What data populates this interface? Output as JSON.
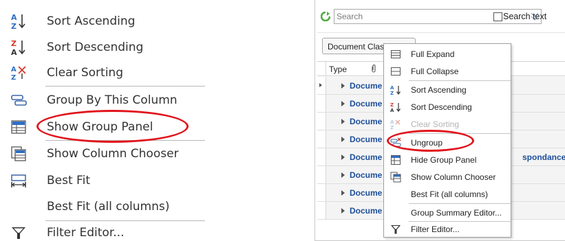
{
  "left_menu": {
    "items": [
      {
        "label": "Sort Ascending",
        "icon": "sort-ascending-icon"
      },
      {
        "label": "Sort Descending",
        "icon": "sort-descending-icon"
      },
      {
        "label": "Clear Sorting",
        "icon": "clear-sorting-icon"
      },
      {
        "label": "Group By This Column",
        "icon": "group-by-column-icon"
      },
      {
        "label": "Show Group Panel",
        "icon": "show-group-panel-icon"
      },
      {
        "label": "Show Column Chooser",
        "icon": "column-chooser-icon"
      },
      {
        "label": "Best Fit",
        "icon": "best-fit-icon"
      },
      {
        "label": "Best Fit (all columns)",
        "icon": ""
      },
      {
        "label": "Filter Editor...",
        "icon": "filter-icon"
      }
    ]
  },
  "app": {
    "search": {
      "placeholder": "Search"
    },
    "search_text_label": "Search text",
    "group_chip": "Document Clas",
    "columns": {
      "type": "Type"
    },
    "rows": [
      "Docume",
      "Docume",
      "Docume",
      "Docume",
      "Docume",
      "Docume",
      "Docume",
      "Docume"
    ],
    "side_text": "spondance",
    "context_menu": {
      "items": [
        {
          "label": "Full Expand",
          "icon": "full-expand-icon",
          "disabled": false
        },
        {
          "label": "Full Collapse",
          "icon": "full-collapse-icon",
          "disabled": false
        },
        {
          "label": "Sort Ascending",
          "icon": "sort-ascending-icon",
          "disabled": false
        },
        {
          "label": "Sort Descending",
          "icon": "sort-descending-icon",
          "disabled": false
        },
        {
          "label": "Clear Sorting",
          "icon": "clear-sorting-icon",
          "disabled": true
        },
        {
          "label": "Ungroup",
          "icon": "ungroup-icon",
          "disabled": false
        },
        {
          "label": "Hide Group Panel",
          "icon": "hide-group-panel-icon",
          "disabled": false
        },
        {
          "label": "Show Column Chooser",
          "icon": "column-chooser-icon",
          "disabled": false
        },
        {
          "label": "Best Fit (all columns)",
          "icon": "",
          "disabled": false
        },
        {
          "label": "Group Summary Editor...",
          "icon": "",
          "disabled": false
        },
        {
          "label": "Filter Editor...",
          "icon": "filter-icon",
          "disabled": false
        }
      ]
    }
  },
  "colors": {
    "highlight_ring": "#e1141c",
    "link_text": "#1e4f9a",
    "icon_blue": "#2f6fc4",
    "icon_red": "#d23a2a"
  }
}
